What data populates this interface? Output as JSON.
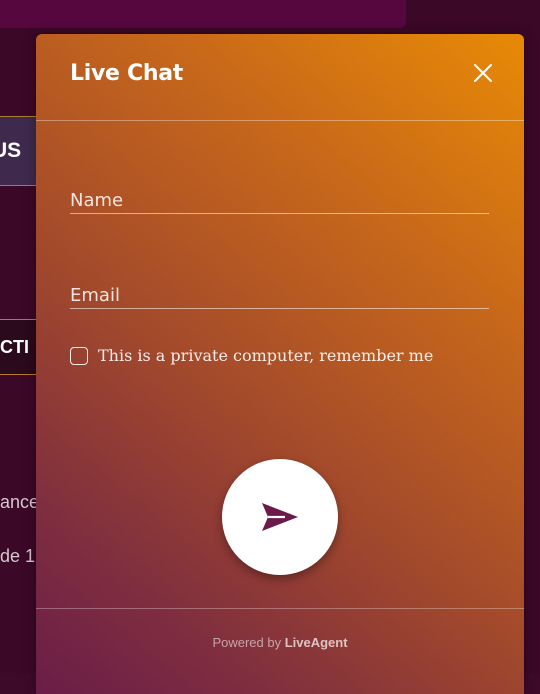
{
  "background": {
    "tab1_text": "US",
    "tab2_text": "ECTI",
    "text1": "dance",
    "text2": "de 1"
  },
  "chat": {
    "title": "Live Chat",
    "close_icon": "close-icon",
    "name_placeholder": "Name",
    "name_value": "",
    "email_placeholder": "Email",
    "email_value": "",
    "remember_label": "This is a private computer, remember me",
    "remember_checked": false,
    "send_icon": "send-arrow-icon",
    "powered_prefix": "Powered by",
    "powered_brand": "LiveAgent"
  },
  "colors": {
    "page_bg": "#3b0827",
    "gradient_top": "#e88a06",
    "gradient_bottom": "#6a1d48",
    "send_arrow": "#6c1a4a"
  }
}
